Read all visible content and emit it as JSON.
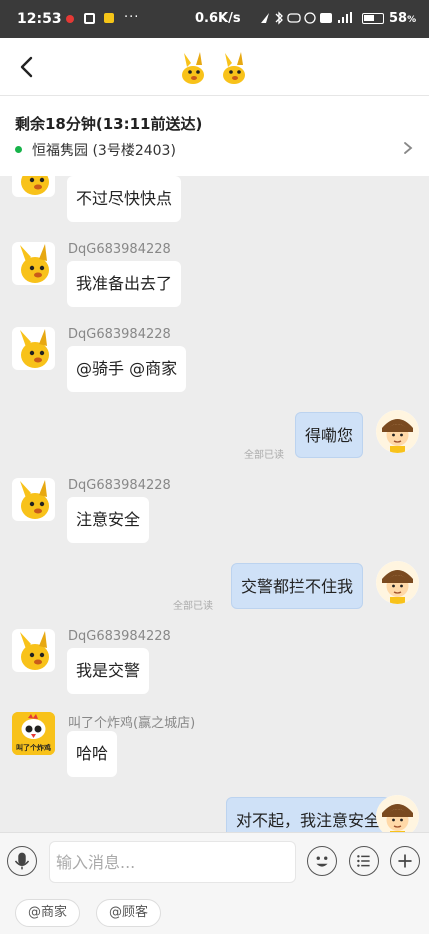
{
  "status_bar": {
    "time": "12:53",
    "more": "···",
    "net_speed": "0.6K/s",
    "icons": [
      "location-icon",
      "bluetooth-icon",
      "vibrate-icon",
      "alarm-icon",
      "hd-icon",
      "signal-icon",
      "battery-icon"
    ],
    "battery": "58",
    "battery_unit": "%",
    "battery_level": 0.58
  },
  "header": {
    "back": "back-icon",
    "logos": [
      "rider-mascot-icon",
      "merchant-mascot-icon"
    ]
  },
  "delivery": {
    "eta": "剩余18分钟(13:11前送达)",
    "address": "恒福隽园 (3号楼2403)",
    "status_color": "#17b34a"
  },
  "messages": [
    {
      "dir": "in",
      "sender": "",
      "text": "不过尽快快点",
      "avatar": "kangaroo-avatar"
    },
    {
      "dir": "in",
      "sender": "DqG683984228",
      "text": "我准备出去了",
      "avatar": "kangaroo-avatar"
    },
    {
      "dir": "in",
      "sender": "DqG683984228",
      "text": "@骑手 @商家",
      "avatar": "kangaroo-avatar"
    },
    {
      "dir": "out",
      "text": "得嘞您",
      "read": "全部已读",
      "avatar": "rider-avatar"
    },
    {
      "dir": "in",
      "sender": "DqG683984228",
      "text": "注意安全",
      "avatar": "kangaroo-avatar"
    },
    {
      "dir": "out",
      "text": "交警都拦不住我",
      "read": "全部已读",
      "avatar": "rider-avatar"
    },
    {
      "dir": "in",
      "sender": "DqG683984228",
      "text": "我是交警",
      "avatar": "kangaroo-avatar"
    },
    {
      "dir": "in",
      "sender": "叫了个炸鸡(赢之城店)",
      "text": "哈哈",
      "avatar": "chicken-shop-avatar",
      "avatar_text": "叫了个炸鸡"
    },
    {
      "dir": "out",
      "text": "对不起，我注意安全",
      "read": "",
      "avatar": "rider-avatar"
    }
  ],
  "input": {
    "placeholder": "输入消息..."
  },
  "quick_tags": [
    "@商家",
    "@顾客"
  ],
  "colors": {
    "brand_yellow": "#f8c21a",
    "bubble_out": "#cfe1f7",
    "bubble_in": "#ffffff"
  }
}
